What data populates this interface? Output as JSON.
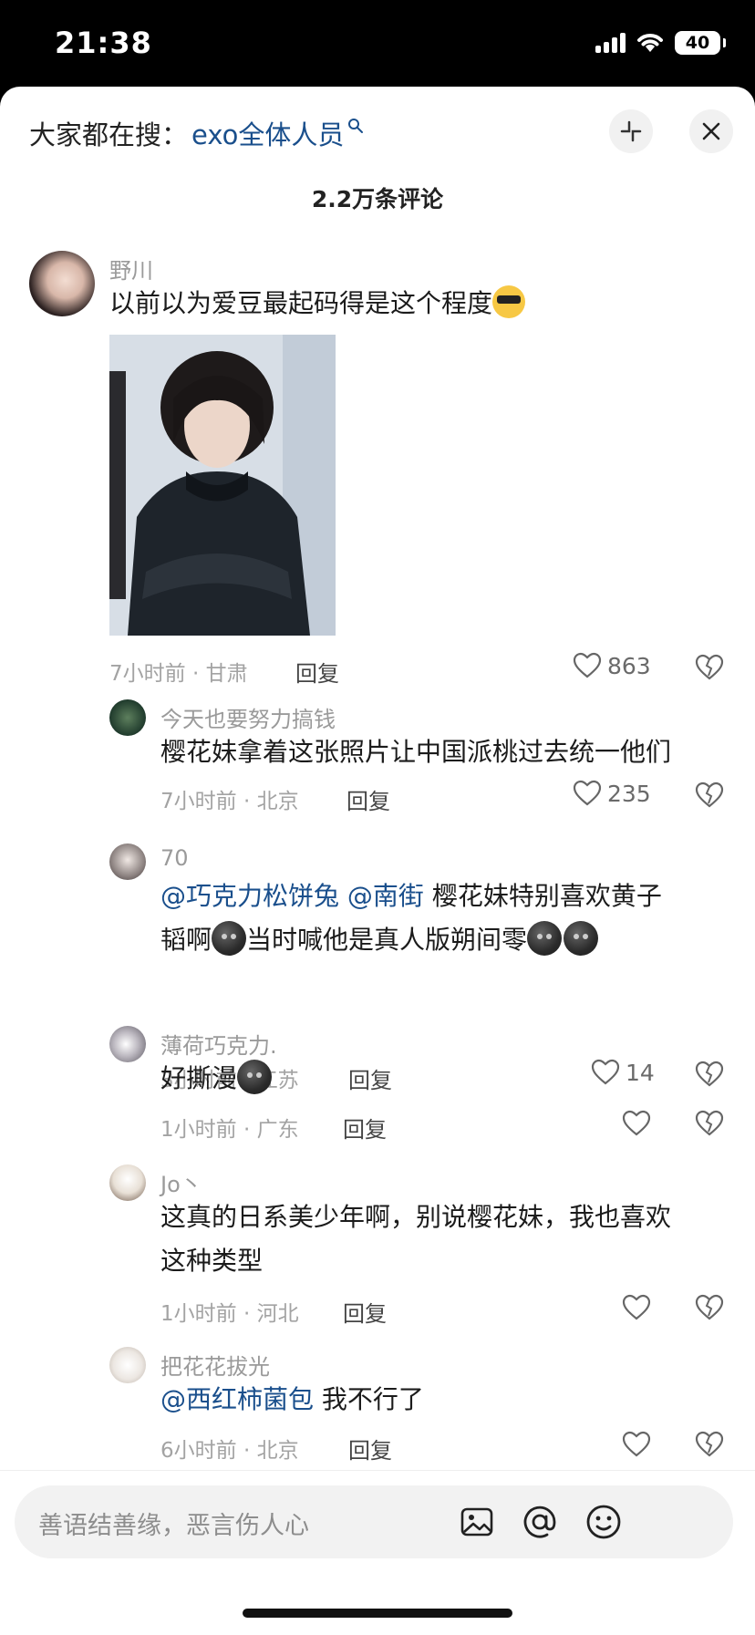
{
  "status_bar": {
    "time": "21:38",
    "battery": "40"
  },
  "header": {
    "search_prefix": "大家都在搜：",
    "search_term": "exo全体人员",
    "comment_count": "2.2万条评论"
  },
  "comments": [
    {
      "user": "野川",
      "text": "以前以为爱豆最起码得是这个程度",
      "meta": "7小时前 · 甘肃",
      "reply": "回复",
      "likes": "863"
    },
    {
      "user": "今天也要努力搞钱",
      "text": "樱花妹拿着这张照片让中国派桃过去统一他们",
      "meta": "7小时前 · 北京",
      "reply": "回复",
      "likes": "235"
    },
    {
      "user": "70",
      "mention1": "@巧克力松饼兔",
      "mention2": "@南街",
      "text_a": "樱花妹特别喜欢黄子",
      "text_b": "韬啊",
      "text_c": "当时喊他是真人版朔间零",
      "meta": "3小时前 · 江苏",
      "reply": "回复",
      "likes": "14"
    },
    {
      "user": "薄荷巧克力.",
      "text": "好撕漫",
      "meta": "1小时前 · 广东",
      "reply": "回复"
    },
    {
      "user": "Jo丶",
      "text_line1": "这真的日系美少年啊，别说樱花妹，我也喜欢",
      "text_line2": "这种类型",
      "meta": "1小时前 · 河北",
      "reply": "回复"
    },
    {
      "user": "把花花拔光",
      "mention": "@西红柿菌包",
      "text": "我不行了",
      "meta": "6小时前 · 北京",
      "reply": "回复"
    }
  ],
  "input": {
    "placeholder": "善语结善缘，恶言伤人心"
  }
}
